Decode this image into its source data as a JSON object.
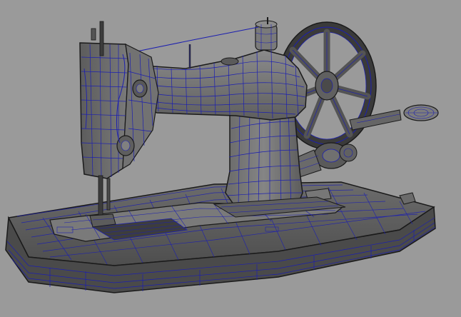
{
  "viewport": {
    "background": "#9a9a9a",
    "mesh_fill": "#6f6f6f",
    "mesh_fill_dark": "#4f4f4f",
    "mesh_fill_light": "#8a8a8a",
    "wire_color": "#1c1fb0",
    "edge_color": "#1a1a1a"
  },
  "model": {
    "icon": "sewing-machine-wireframe-icon"
  }
}
